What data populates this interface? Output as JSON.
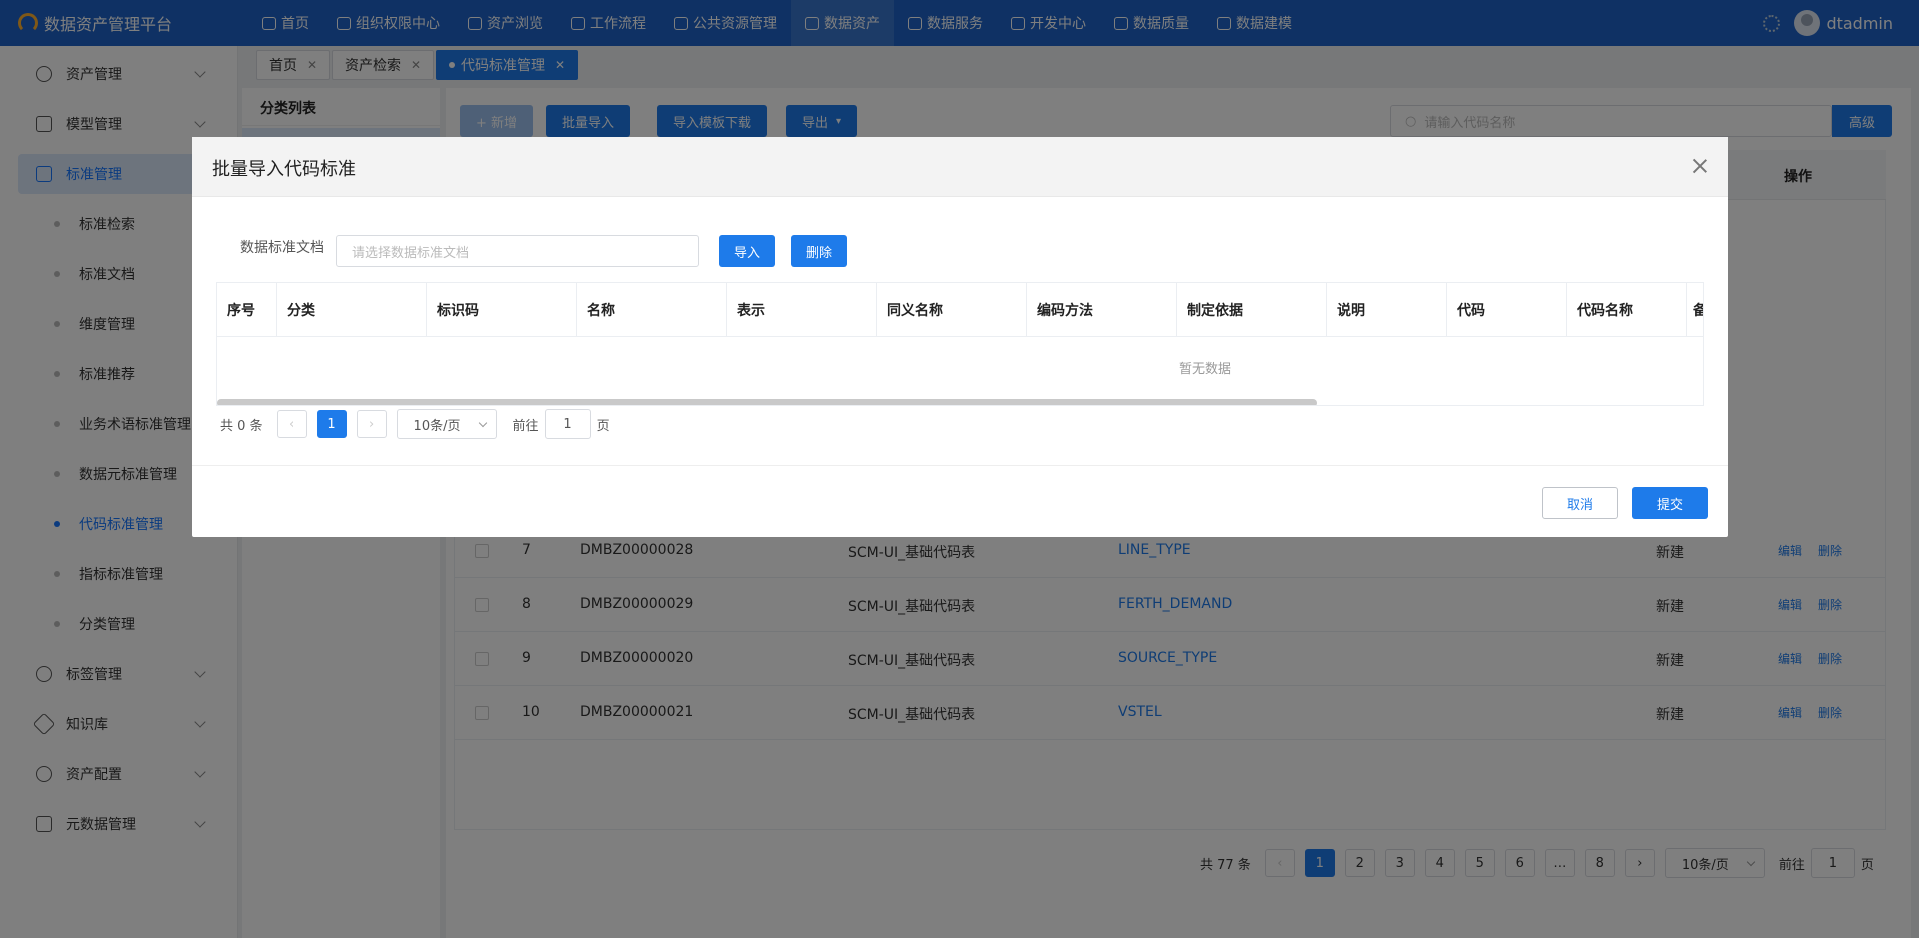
{
  "app_title": "数据资产管理平台",
  "nav": [
    "首页",
    "组织权限中心",
    "资产浏览",
    "工作流程",
    "公共资源管理",
    "数据资产",
    "数据服务",
    "开发中心",
    "数据质量",
    "数据建模"
  ],
  "nav_active_index": 5,
  "user": "dtadmin",
  "sidebar": {
    "top_groups": [
      "资产管理",
      "模型管理",
      "标准管理"
    ],
    "standard_children": [
      "标准检索",
      "标准文档",
      "维度管理",
      "标准推荐",
      "业务术语标准管理",
      "数据元标准管理",
      "代码标准管理",
      "指标标准管理",
      "分类管理"
    ],
    "active_child_index": 6,
    "bottom_groups": [
      "标签管理",
      "知识库",
      "资产配置",
      "元数据管理"
    ]
  },
  "tabs": [
    "首页",
    "资产检索",
    "代码标准管理"
  ],
  "category_panel_title": "分类列表",
  "toolbar": {
    "add": "+ 新增",
    "batch_import": "批量导入",
    "template_download": "导入模板下载",
    "export": "导出",
    "search_placeholder": "请输入代码名称",
    "advanced": "高级"
  },
  "table": {
    "op_header": "操作",
    "edit": "编辑",
    "delete": "删除",
    "rows": [
      {
        "no": "7",
        "id": "DMBZ00000028",
        "cat": "SCM-UI_基础代码表",
        "name": "LINE_TYPE",
        "status": "新建"
      },
      {
        "no": "8",
        "id": "DMBZ00000029",
        "cat": "SCM-UI_基础代码表",
        "name": "FERTH_DEMAND",
        "status": "新建"
      },
      {
        "no": "9",
        "id": "DMBZ00000020",
        "cat": "SCM-UI_基础代码表",
        "name": "SOURCE_TYPE",
        "status": "新建"
      },
      {
        "no": "10",
        "id": "DMBZ00000021",
        "cat": "SCM-UI_基础代码表",
        "name": "VSTEL",
        "status": "新建"
      }
    ]
  },
  "pagination": {
    "total": "共 77 条",
    "pages": [
      "1",
      "2",
      "3",
      "4",
      "5",
      "6",
      "…",
      "8"
    ],
    "page_size": "10条/页",
    "goto_prefix": "前往",
    "goto_value": "1",
    "goto_suffix": "页"
  },
  "modal": {
    "title": "批量导入代码标准",
    "doc_label": "数据标准文档",
    "doc_placeholder": "请选择数据标准文档",
    "import_btn": "导入",
    "delete_btn": "删除",
    "columns": [
      "序号",
      "分类",
      "标识码",
      "名称",
      "表示",
      "同义名称",
      "编码方法",
      "制定依据",
      "说明",
      "代码",
      "代码名称",
      "备"
    ],
    "empty_text": "暂无数据",
    "pagination": {
      "total": "共 0 条",
      "current": "1",
      "page_size": "10条/页",
      "goto_prefix": "前往",
      "goto_value": "1",
      "goto_suffix": "页"
    },
    "cancel": "取消",
    "submit": "提交"
  }
}
